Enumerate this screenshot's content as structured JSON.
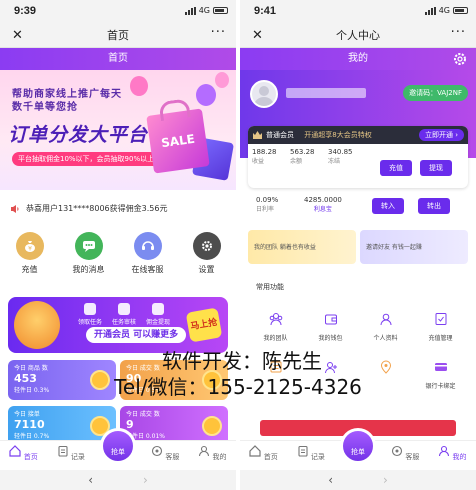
{
  "left": {
    "status": {
      "time": "9:39",
      "network": "4G"
    },
    "navbar": {
      "close": "✕",
      "title": "首页",
      "more": "···"
    },
    "titlebar": {
      "title": "首页"
    },
    "banner": {
      "slogan": "帮助商家线上推广每天数千单等您抢",
      "headline": "订单分发大平台",
      "promo": "平台抽取佣金10%以下，会员抽取90%以上",
      "bag_text": "SALE"
    },
    "notice": {
      "text": "恭喜用户131****8006获得佣金3.56元"
    },
    "icons": [
      {
        "label": "充值",
        "icon": "money-bag-icon",
        "color": "#e5b45c"
      },
      {
        "label": "我的消息",
        "icon": "chat-bubble-icon",
        "color": "#43b55a"
      },
      {
        "label": "在线客服",
        "icon": "headset-icon",
        "color": "#6f8cf2"
      },
      {
        "label": "设置",
        "icon": "gear-icon",
        "color": "#555555"
      }
    ],
    "promo_banner": {
      "steps": [
        "领取任务",
        "任务审核",
        "佣金提现"
      ],
      "cta_text": "开通会员 可以赚更多",
      "go_button": "马上抢"
    },
    "stats": [
      {
        "title": "今日 商品 数",
        "value": "453",
        "sub": "轻件日 0.3%",
        "color": "#7a64f0"
      },
      {
        "title": "今日 成交 数",
        "value": "90",
        "sub": "轻件日 0.5%",
        "color": "#f2a14a"
      },
      {
        "title": "今日 接单",
        "value": "7110",
        "sub": "轻件日 0.7%",
        "color": "#49a7f0"
      },
      {
        "title": "今日 成交 数",
        "value": "9",
        "sub": "轻件日 0.01%",
        "color": "#b54fe6"
      }
    ],
    "tabbar": [
      {
        "label": "首页",
        "icon": "home-icon",
        "active": true
      },
      {
        "label": "记录",
        "icon": "clipboard-icon",
        "active": false
      },
      {
        "label": "抢单",
        "icon": "grab-order-icon",
        "active": false
      },
      {
        "label": "客服",
        "icon": "service-icon",
        "active": false
      },
      {
        "label": "我的",
        "icon": "user-icon",
        "active": false
      }
    ],
    "bottom_nav": {
      "back": "‹",
      "forward": "›"
    }
  },
  "right": {
    "status": {
      "time": "9:41",
      "network": "4G"
    },
    "navbar": {
      "close": "✕",
      "title": "个人中心",
      "more": "···"
    },
    "titlebar": {
      "title": "我的"
    },
    "invite": {
      "label": "邀请码：VAJ2NF"
    },
    "vip": {
      "level": "普通会员",
      "hint": "开通超享8大会员特权",
      "open_button": "立即开通 ›",
      "stats": [
        {
          "value": "188.28",
          "label": "收益"
        },
        {
          "value": "563.28",
          "label": "余额"
        },
        {
          "value": "340.85",
          "label": "冻结"
        }
      ],
      "recharge": "充值",
      "withdraw": "提现"
    },
    "wallet": {
      "rate_value": "0.09%",
      "rate_label": "日利率",
      "amount_value": "4285.0000",
      "amount_label": "利息宝",
      "transfer_in": "转入",
      "transfer_out": "转出"
    },
    "team": {
      "my_team": "我的团队 躺着也有收益",
      "invite_friend": "邀请好友 有钱一起赚"
    },
    "section_title": "常用功能",
    "functions": [
      {
        "label": "我的团队",
        "icon": "team-icon"
      },
      {
        "label": "我的钱包",
        "icon": "wallet-icon"
      },
      {
        "label": "个人资料",
        "icon": "profile-icon"
      },
      {
        "label": "充值管理",
        "icon": "recharge-icon"
      },
      {
        "label": "",
        "icon": "record-icon"
      },
      {
        "label": "",
        "icon": "invite-icon"
      },
      {
        "label": "",
        "icon": "location-icon"
      },
      {
        "label": "银行卡绑定",
        "icon": "bank-card-icon"
      }
    ],
    "tabbar": [
      {
        "label": "首页",
        "icon": "home-icon",
        "active": false
      },
      {
        "label": "记录",
        "icon": "clipboard-icon",
        "active": false
      },
      {
        "label": "抢单",
        "icon": "grab-order-icon",
        "active": false
      },
      {
        "label": "客服",
        "icon": "service-icon",
        "active": false
      },
      {
        "label": "我的",
        "icon": "user-icon",
        "active": true
      }
    ],
    "bottom_nav": {
      "back": "‹",
      "forward": "›"
    }
  },
  "watermark": {
    "line1": "软件开发：陈先生",
    "line2": "Tel/微信：155-2125-4326"
  },
  "colors": {
    "accent": "#7b3ff0",
    "header_gradient_start": "#8b3cf2",
    "header_gradient_end": "#b04be8"
  }
}
